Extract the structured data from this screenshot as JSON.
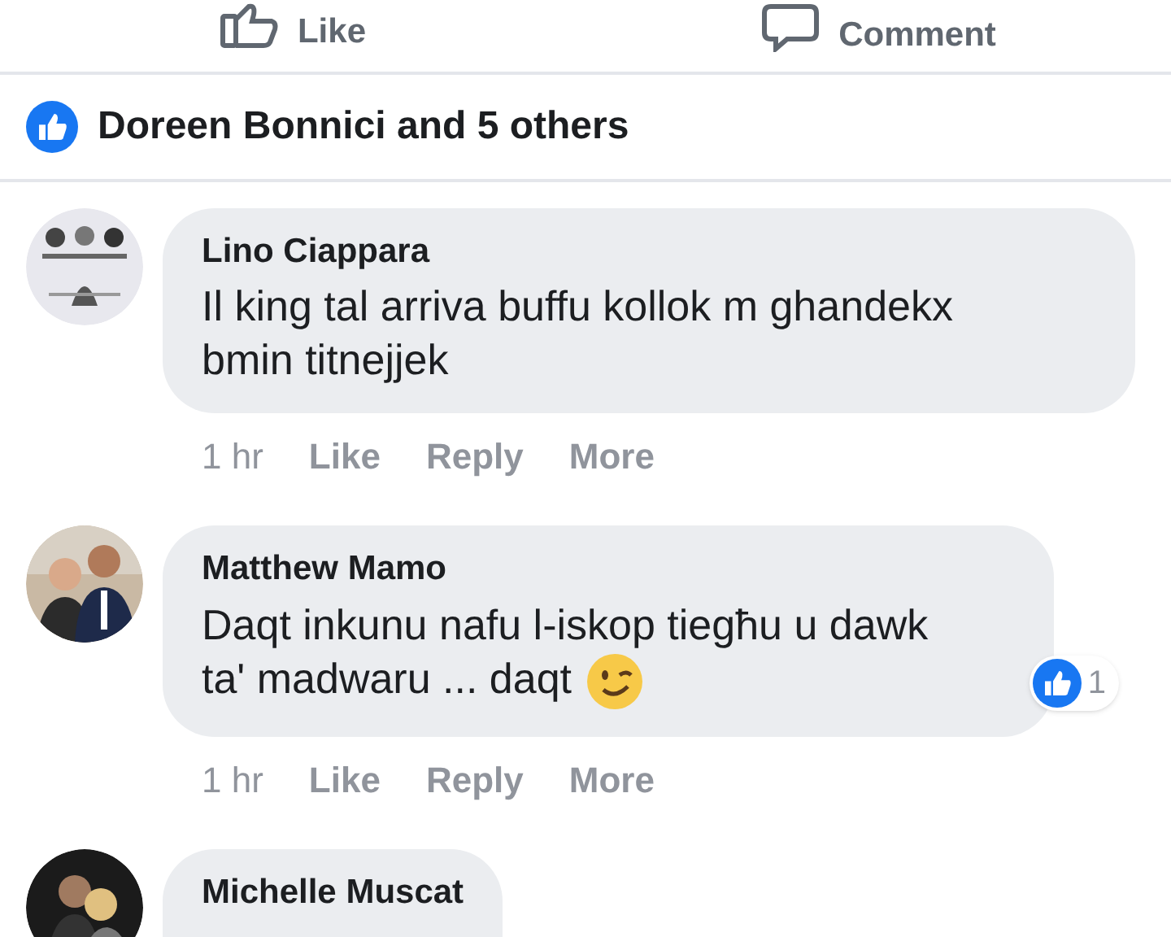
{
  "actions": [
    {
      "kind": "like",
      "label": "Like"
    },
    {
      "kind": "comment",
      "label": "Comment"
    }
  ],
  "likes_summary": {
    "text": "Doreen Bonnici and 5 others"
  },
  "comments": [
    {
      "author": "Lino Ciappara",
      "text": "Il king tal arriva buffu kollok m ghandekx bmin titnejjek",
      "meta": [
        "1 hr",
        "Like",
        "Reply",
        "More"
      ]
    },
    {
      "author": "Matthew Mamo",
      "text": "Daqt inkunu nafu l-iskop tiegħu u dawk ta' madwaru ... daqt",
      "wink_emoji": true,
      "reaction_count": "1",
      "meta": [
        "1 hr",
        "Like",
        "Reply",
        "More"
      ]
    },
    {
      "author": "Michelle Muscat"
    }
  ]
}
